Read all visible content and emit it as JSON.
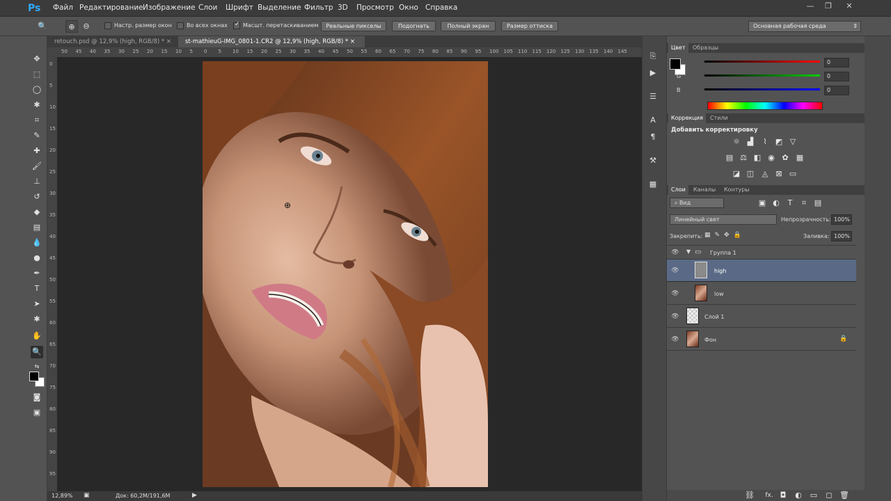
{
  "app": {
    "logo": "Ps"
  },
  "menu": [
    "Файл",
    "Редактирование",
    "Изображение",
    "Слои",
    "Шрифт",
    "Выделение",
    "Фильтр",
    "3D",
    "Просмотр",
    "Окно",
    "Справка"
  ],
  "window_controls": [
    "—",
    "❐",
    "✕"
  ],
  "options": {
    "resize_windows": "Настр. размер окон",
    "all_windows": "Во всех окнах",
    "scrubby_zoom": "Масшт. перетаскиванием",
    "actual_pixels": "Реальные пикселы",
    "fit_screen": "Подогнать",
    "fill_screen": "Полный экран",
    "print_size": "Размер оттиска",
    "workspace": "Основная рабочая среда"
  },
  "tabs": [
    {
      "label": "retouch.psd @ 12,9% (high, RGB/8) *",
      "close": "×"
    },
    {
      "label": "st-mathieuG-IMG_0801-1.CR2 @ 12,9% (high, RGB/8) *",
      "close": "×"
    }
  ],
  "ruler_h": [
    "50",
    "45",
    "40",
    "35",
    "30",
    "25",
    "20",
    "15",
    "10",
    "5",
    "0",
    "5",
    "10",
    "15",
    "20",
    "25",
    "30",
    "35",
    "40",
    "45",
    "50",
    "55",
    "60",
    "65",
    "70",
    "75",
    "80",
    "85",
    "90",
    "95",
    "100",
    "105",
    "110",
    "115",
    "120",
    "125",
    "130",
    "135",
    "140",
    "145"
  ],
  "ruler_v": [
    "0",
    "5",
    "10",
    "15",
    "20",
    "25",
    "30",
    "35",
    "40",
    "45",
    "50",
    "55",
    "60",
    "65",
    "70",
    "75",
    "80",
    "85",
    "90",
    "95"
  ],
  "status": {
    "zoom": "12,89%",
    "doc": "Док: 60,2M/191,6M"
  },
  "color_panel": {
    "tabs": [
      "Цвет",
      "Образцы"
    ],
    "channels": [
      {
        "label": "R",
        "value": "0",
        "color": "#ff0000"
      },
      {
        "label": "G",
        "value": "0",
        "color": "#00cc00"
      },
      {
        "label": "B",
        "value": "0",
        "color": "#0000ff"
      }
    ]
  },
  "adjust_panel": {
    "tabs": [
      "Коррекция",
      "Стили"
    ],
    "title": "Добавить корректировку",
    "row1": [
      "brightness-icon",
      "levels-icon",
      "curves-icon",
      "exposure-icon",
      "vibrance-icon"
    ],
    "row2": [
      "hue-saturation-icon",
      "color-balance-icon",
      "black-white-icon",
      "photo-filter-icon",
      "channel-mixer-icon",
      "color-lookup-icon"
    ],
    "row3": [
      "invert-icon",
      "posterize-icon",
      "threshold-icon",
      "selective-color-icon",
      "gradient-map-icon"
    ]
  },
  "layers_panel": {
    "tabs": [
      "Слои",
      "Каналы",
      "Контуры"
    ],
    "filter": "Вид",
    "blend_mode": "Линейный свет",
    "opacity_label": "Непрозрачность:",
    "opacity": "100%",
    "lock_label": "Закрепить:",
    "fill_label": "Заливка:",
    "fill": "100%",
    "layers": [
      {
        "name": "Группа 1",
        "type": "group"
      },
      {
        "name": "high",
        "type": "gray",
        "selected": true
      },
      {
        "name": "low",
        "type": "photo"
      },
      {
        "name": "Слой 1",
        "type": "transparent"
      },
      {
        "name": "Фон",
        "type": "photo-bg"
      }
    ],
    "footer_icons": [
      "link-icon",
      "fx-icon",
      "mask-icon",
      "adjustment-icon",
      "folder-icon",
      "new-layer-icon",
      "trash-icon"
    ],
    "footer_fx": "fx."
  },
  "colors": {
    "accent": "#31a8ff",
    "selected_layer": "#5a6a86"
  }
}
